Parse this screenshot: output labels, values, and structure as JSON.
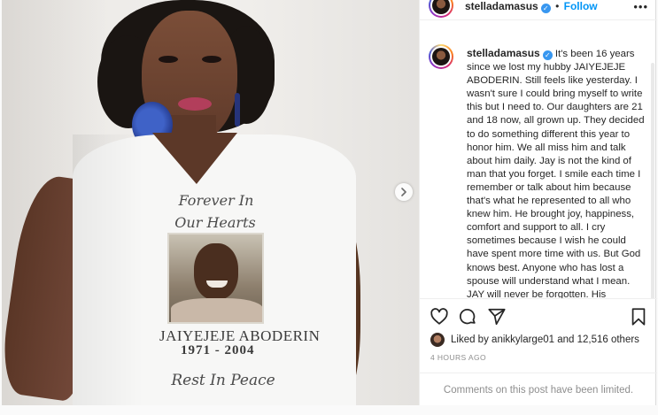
{
  "post": {
    "header": {
      "username": "stelladamasus",
      "separator": "•",
      "follow_label": "Follow",
      "more_glyph": "•••"
    },
    "caption": {
      "username": "stelladamasus",
      "text": "It's been 16 years since we lost my hubby JAIYEJEJE ABODERIN. Still feels like yesterday. I wasn't sure I could bring myself to write this but I need to. Our daughters are 21 and 18 now, all grown up. They decided to do something different this year to honor him. We all miss him and talk about him daily. Jay is not the kind of man that you forget. I smile each time I remember or talk about him because that's what he represented to all who knew him. He brought joy, happiness, comfort and support to all. I cry sometimes because I wish he could have spent more time with us. But God knows best. Anyone who has lost a spouse will understand what I mean. JAY will never be forgotten. His"
    },
    "likes": {
      "prefix": "Liked by",
      "user": "anikkylarge01",
      "suffix": "and 12,516 others"
    },
    "timestamp": "4 HOURS AGO",
    "comments_notice": "Comments on this post have been limited."
  },
  "photo": {
    "shirt_text_line1": "Forever In",
    "shirt_text_line2": "Our Hearts",
    "shirt_name": "JAIYEJEJE ABODERIN",
    "shirt_years": "1971 - 2004",
    "shirt_text_bottom": "Rest In Peace"
  },
  "icons": {
    "verified": "verified-badge-icon",
    "like": "heart-icon",
    "comment": "comment-icon",
    "share": "paper-plane-icon",
    "save": "bookmark-icon",
    "next": "chevron-right-icon",
    "more": "more-options-icon"
  },
  "colors": {
    "link_blue": "#0095f6",
    "verified_blue": "#3897f0",
    "muted_text": "#8e8e8e",
    "text": "#262626"
  }
}
